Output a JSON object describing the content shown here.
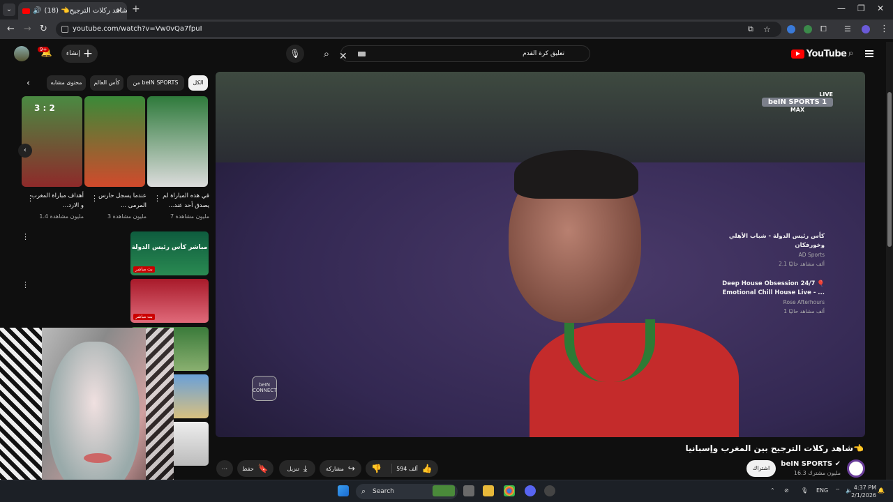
{
  "browser": {
    "tab_title": "(18) 👈شاهد ركلات الترجيح",
    "url": "youtube.com/watch?v=Vw0vQa7fpuI"
  },
  "youtube": {
    "logo_text": "YouTube",
    "logo_region": "JO",
    "search_value": "تعليق كرة القدم",
    "create_label": "إنشاء",
    "notification_count": "9+"
  },
  "player": {
    "channel_overlay": "beIN SPORTS",
    "channel_overlay_num": "1",
    "live_label": "LIVE",
    "max_label": "MAX",
    "connect_label": "beIN CONNECT"
  },
  "video": {
    "title": "👈شاهد ركلات الترجيح بين المغرب وإسبانيا",
    "channel": "beIN SPORTS",
    "subscribers": "16.3 مليون مشترك",
    "subscribe_label": "اشتراك",
    "likes": "594 ألف",
    "share_label": "مشاركة",
    "download_label": "تنزيل",
    "save_label": "حفظ"
  },
  "chips": [
    "الكل",
    "من beIN SPORTS",
    "كأس العالم",
    "محتوى مشابه"
  ],
  "shorts": [
    {
      "title": "في هذه المباراة لم يصدق أحد عند...",
      "views": "7 مليون مشاهدة"
    },
    {
      "title": "عندما يسجل حارس المرمى ...",
      "views": "3 مليون مشاهدة"
    },
    {
      "title": "أهداف مباراة المغرب و الارد...",
      "views": "1.4 مليون مشاهدة"
    }
  ],
  "short_overlay_score": "3 : 2",
  "related": [
    {
      "title": "كأس رئيس الدولة - شباب الأهلي وخورفكان",
      "channel": "AD Sports",
      "meta": "2.1 ألف مشاهد حاليًا",
      "live": "بث مباشر"
    },
    {
      "title": "Deep House Obsession 24/7 🎈 Emotional Chill House Live - ...",
      "channel": "Rose Afterhours",
      "meta": "1 ألف مشاهد حاليًا",
      "live": "بث مباشر"
    }
  ],
  "related_thumb_text": "مباشر كأس رئيس الدولة",
  "taskbar": {
    "search_label": "Search",
    "lang": "ENG",
    "time": "4:37 PM",
    "date": "2/1/2026"
  },
  "colors": {
    "accent": "#ff0000",
    "bg": "#0f0f0f",
    "chip_bg": "#272727"
  }
}
